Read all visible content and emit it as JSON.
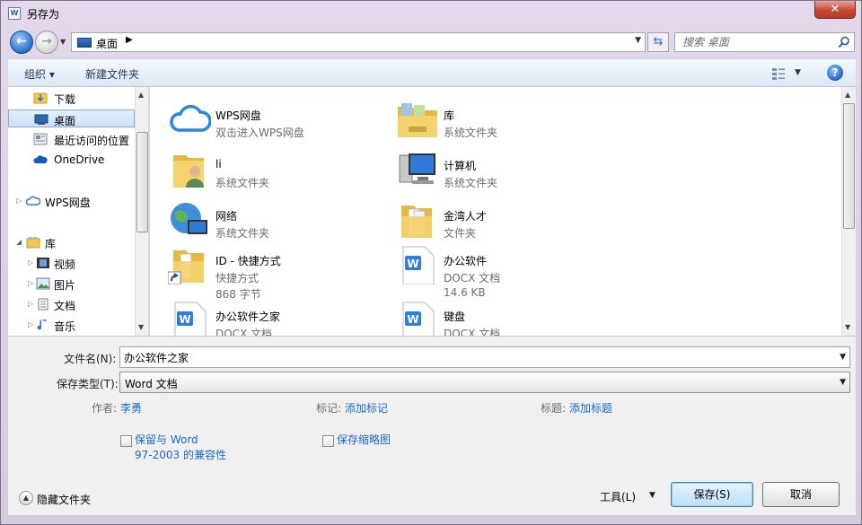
{
  "window": {
    "title": "另存为",
    "close_glyph": "✕",
    "app_icon_text": "W"
  },
  "nav": {
    "back_glyph": "←",
    "forward_glyph": "→",
    "address": "桌面",
    "address_sep": "▶",
    "refresh_glyph": "⇆",
    "search_placeholder": "搜索 桌面"
  },
  "toolbar": {
    "organize": "组织 ▾",
    "new_folder": "新建文件夹",
    "help_glyph": "?"
  },
  "sidebar": {
    "items": [
      {
        "label": "下载"
      },
      {
        "label": "桌面",
        "selected": true
      },
      {
        "label": "最近访问的位置"
      },
      {
        "label": "OneDrive"
      },
      {
        "label": "WPS网盘"
      },
      {
        "label": "库"
      },
      {
        "label": "视频"
      },
      {
        "label": "图片"
      },
      {
        "label": "文档"
      },
      {
        "label": "音乐"
      }
    ]
  },
  "files": [
    {
      "name": "WPS网盘",
      "line1": "双击进入WPS网盘",
      "line2": "",
      "icon": "cloud-icon"
    },
    {
      "name": "库",
      "line1": "系统文件夹",
      "line2": "",
      "icon": "library-folder-icon"
    },
    {
      "name": "li",
      "line1": "系统文件夹",
      "line2": "",
      "icon": "user-folder-icon"
    },
    {
      "name": "计算机",
      "line1": "系统文件夹",
      "line2": "",
      "icon": "computer-icon"
    },
    {
      "name": "网络",
      "line1": "系统文件夹",
      "line2": "",
      "icon": "network-globe-icon"
    },
    {
      "name": "金湾人才",
      "line1": "文件夹",
      "line2": "",
      "icon": "folder-icon"
    },
    {
      "name": "ID - 快捷方式",
      "line1": "快捷方式",
      "line2": "868 字节",
      "icon": "shortcut-folder-icon"
    },
    {
      "name": "办公软件",
      "line1": "DOCX 文档",
      "line2": "14.6 KB",
      "icon": "wps-doc-icon"
    },
    {
      "name": "办公软件之家",
      "line1": "DOCX 文档",
      "line2": "",
      "icon": "wps-doc-icon"
    },
    {
      "name": "键盘",
      "line1": "DOCX 文档",
      "line2": "",
      "icon": "wps-doc-icon"
    }
  ],
  "form": {
    "filename_label": "文件名(N):",
    "filename_value": "办公软件之家",
    "filetype_label": "保存类型(T):",
    "filetype_value": "Word 文档",
    "author_label": "作者:",
    "author_value": "李勇",
    "tags_label": "标记:",
    "tags_value": "添加标记",
    "title_label": "标题:",
    "title_value": "添加标题",
    "compat_line1": "保留与 Word",
    "compat_line2": "97-2003 的兼容性",
    "thumbnail_label": "保存缩略图"
  },
  "footer": {
    "hide_folders": "隐藏文件夹",
    "tools": "工具(L)",
    "save": "保存(S)",
    "cancel": "取消"
  },
  "colors": {
    "accent": "#1f68c2",
    "selection": "#cce2f8",
    "frame": "#d6cadf"
  }
}
